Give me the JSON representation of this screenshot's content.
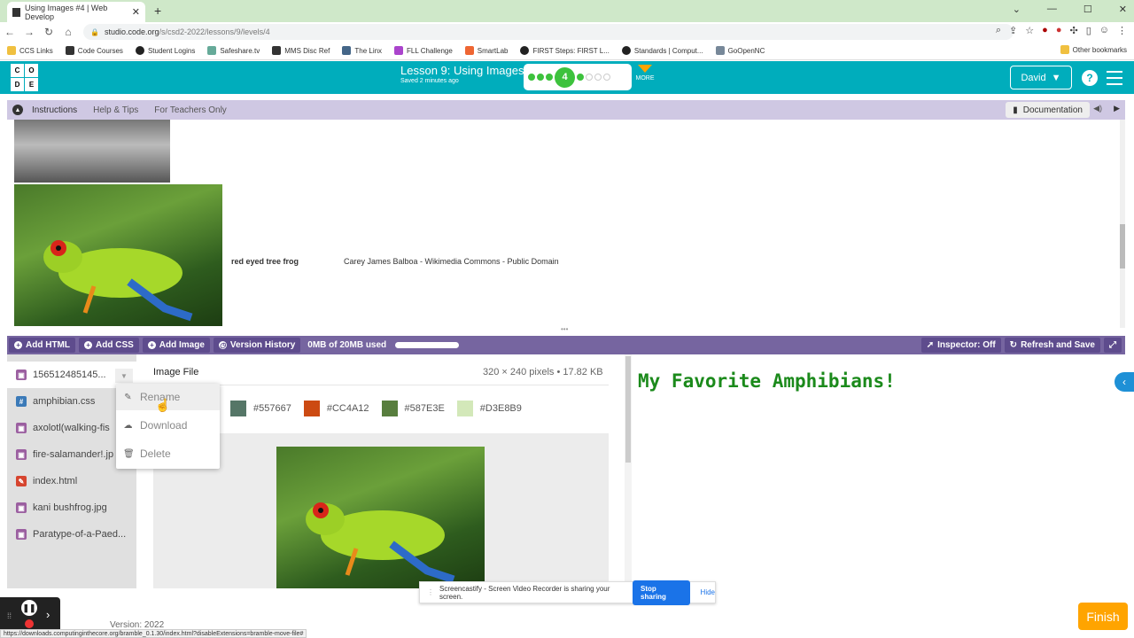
{
  "browser": {
    "tab_title": "Using Images #4 | Web Develop",
    "url_host": "studio.code.org",
    "url_path": "/s/csd2-2022/lessons/9/levels/4",
    "bookmarks": [
      "CCS Links",
      "Code Courses",
      "Student Logins",
      "Safeshare.tv",
      "MMS Disc Ref",
      "The Linx",
      "FLL Challenge",
      "SmartLab",
      "FIRST Steps: FIRST L...",
      "Standards | Comput...",
      "GoOpenNC"
    ],
    "other_bookmarks": "Other bookmarks"
  },
  "header": {
    "logo_letters": [
      "C",
      "O",
      "D",
      "E"
    ],
    "lesson_title": "Lesson 9: Using Images",
    "saved_text": "Saved 2 minutes ago",
    "current_level": "4",
    "more_label": "MORE",
    "user_name": "David"
  },
  "instructions": {
    "tabs": [
      "Instructions",
      "Help & Tips",
      "For Teachers Only"
    ],
    "documentation_label": "Documentation",
    "frog_label": "red eyed tree frog",
    "frog_source": "Carey James Balboa - Wikimedia Commons - Public Domain"
  },
  "toolbar": {
    "add_html": "Add HTML",
    "add_css": "Add CSS",
    "add_image": "Add Image",
    "version_history": "Version History",
    "usage": "0MB of 20MB used",
    "inspector": "Inspector: Off",
    "refresh": "Refresh and Save"
  },
  "files": [
    {
      "name": "156512485145...",
      "type": "img"
    },
    {
      "name": "amphibian.css",
      "type": "css"
    },
    {
      "name": "axolotl(walking-fis",
      "type": "img"
    },
    {
      "name": "fire-salamander!.jp",
      "type": "img"
    },
    {
      "name": "index.html",
      "type": "html"
    },
    {
      "name": "kani bushfrog.jpg",
      "type": "img"
    },
    {
      "name": "Paratype-of-a-Paed...",
      "type": "img"
    }
  ],
  "context_menu": {
    "rename": "Rename",
    "download": "Download",
    "delete": "Delete"
  },
  "viewer": {
    "title": "Image File",
    "info": "320 × 240 pixels • 17.82 KB",
    "swatches": [
      {
        "hex": "#557667",
        "label": "#557667"
      },
      {
        "hex": "#CC4A12",
        "label": "#CC4A12"
      },
      {
        "hex": "#587E3E",
        "label": "#587E3E"
      },
      {
        "hex": "#D3E8B9",
        "label": "#D3E8B9"
      }
    ]
  },
  "preview": {
    "heading": "My Favorite Amphibians!"
  },
  "screencastify": {
    "message": "Screencastify - Screen Video Recorder is sharing your screen.",
    "stop_label": "Stop sharing",
    "hide_label": "Hide"
  },
  "footer": {
    "version": "Version: 2022",
    "finish_label": "Finish",
    "status_url": "https://downloads.computinginthecore.org/bramble_0.1.30/index.html?disableExtensions=bramble-move-file#"
  },
  "colors": {
    "header_teal": "#00adbc",
    "toolbar_purple": "#7665a0",
    "finish_orange": "#ffa400",
    "preview_green": "#1b8a1b"
  }
}
